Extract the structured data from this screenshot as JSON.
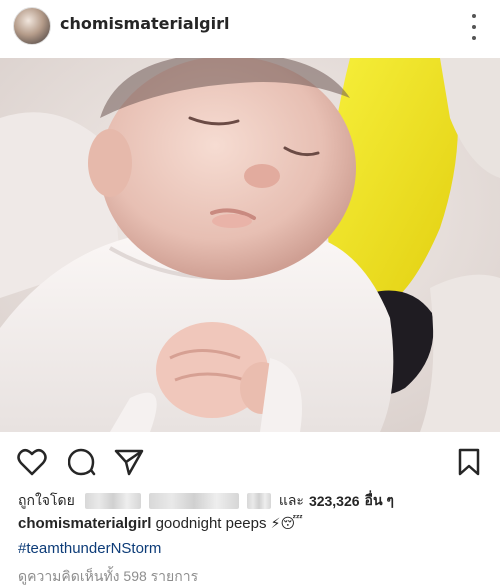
{
  "post": {
    "username": "chomismaterialgirl",
    "more_icon": "more-vertical-icon"
  },
  "actions": {
    "like_icon": "heart-icon",
    "comment_icon": "comment-icon",
    "share_icon": "share-icon",
    "save_icon": "bookmark-icon"
  },
  "likes": {
    "prefix": "ถูกใจโดย",
    "connector": "และ",
    "count": "323,326",
    "suffix": "อื่น ๆ"
  },
  "caption": {
    "username": "chomismaterialgirl",
    "text": "goodnight peeps",
    "emojis": "⚡😴",
    "hashtag": "#teamthunderNStorm"
  },
  "comments": {
    "view_all": "ดูความคิดเห็นทั้ง 598 รายการ"
  },
  "colors": {
    "text": "#262626",
    "hashtag": "#0d3c78",
    "muted": "#8e8e8e"
  }
}
